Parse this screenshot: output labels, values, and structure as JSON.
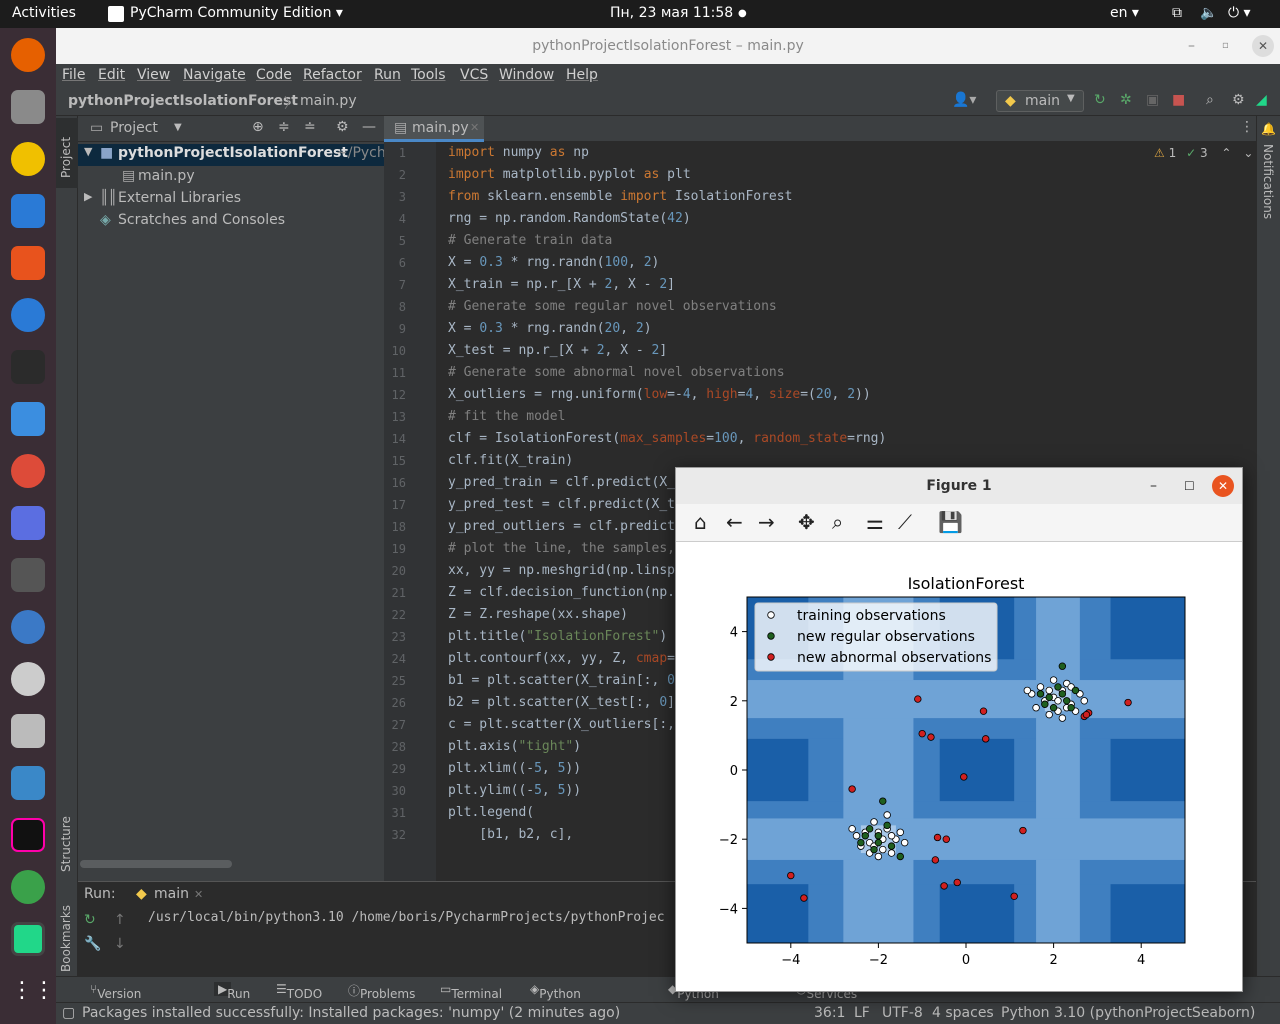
{
  "topbar": {
    "activities": "Activities",
    "app": "PyCharm Community Edition ▾",
    "datetime": "Пн, 23 мая  11:58",
    "lang": "en ▾"
  },
  "window": {
    "title": "pythonProjectIsolationForest – main.py"
  },
  "menu": [
    "File",
    "Edit",
    "View",
    "Navigate",
    "Code",
    "Refactor",
    "Run",
    "Tools",
    "VCS",
    "Window",
    "Help"
  ],
  "nav": {
    "project": "pythonProjectIsolationForest",
    "file": "main.py",
    "run_config": "main"
  },
  "project_panel": {
    "title": "Project",
    "root": "pythonProjectIsolationForest",
    "root_path": "~/Pych",
    "file": "main.py",
    "external": "External Libraries",
    "scratches": "Scratches and Consoles"
  },
  "sidebar": {
    "project": "Project",
    "structure": "Structure",
    "bookmarks": "Bookmarks",
    "notifications": "Notifications"
  },
  "editor": {
    "tab": "main.py",
    "inspections": {
      "warnings": "1",
      "ok": "3"
    },
    "line_numbers": [
      "1",
      "2",
      "3",
      "4",
      "5",
      "6",
      "7",
      "8",
      "9",
      "10",
      "11",
      "12",
      "13",
      "14",
      "15",
      "16",
      "17",
      "18",
      "19",
      "20",
      "21",
      "22",
      "23",
      "24",
      "25",
      "26",
      "27",
      "28",
      "29",
      "30",
      "31",
      "32"
    ]
  },
  "run_panel": {
    "label": "Run:",
    "tab": "main",
    "command": "/usr/local/bin/python3.10 /home/boris/PycharmProjects/pythonProjec"
  },
  "tool_windows": [
    "Version Control",
    "Run",
    "TODO",
    "Problems",
    "Terminal",
    "Python Packages",
    "Python Console",
    "Services"
  ],
  "status": {
    "message": "Packages installed successfully: Installed packages: 'numpy' (2 minutes ago)",
    "position": "36:1",
    "line_sep": "LF",
    "encoding": "UTF-8",
    "indent": "4 spaces",
    "interpreter": "Python 3.10 (pythonProjectSeaborn)"
  },
  "figure": {
    "window_title": "Figure 1"
  },
  "chart_data": {
    "type": "scatter",
    "title": "IsolationForest",
    "xlim": [
      -5,
      5
    ],
    "ylim": [
      -5,
      5
    ],
    "xticks": [
      -4,
      -2,
      0,
      2,
      4
    ],
    "yticks": [
      -4,
      -2,
      0,
      2,
      4
    ],
    "legend_position": "top-left",
    "background": "contourf (Blues)",
    "series": [
      {
        "name": "training observations",
        "color": "#ffffff",
        "points": [
          [
            2.0,
            2.1
          ],
          [
            2.2,
            2.3
          ],
          [
            1.8,
            2.0
          ],
          [
            2.4,
            1.9
          ],
          [
            2.1,
            1.7
          ],
          [
            1.7,
            2.4
          ],
          [
            2.3,
            2.5
          ],
          [
            2.6,
            2.2
          ],
          [
            1.9,
            1.6
          ],
          [
            2.5,
            1.7
          ],
          [
            1.5,
            2.2
          ],
          [
            2.0,
            2.6
          ],
          [
            2.2,
            1.5
          ],
          [
            1.6,
            1.8
          ],
          [
            2.7,
            2.0
          ],
          [
            1.4,
            2.3
          ],
          [
            2.4,
            2.4
          ],
          [
            2.1,
            2.0
          ],
          [
            1.9,
            2.3
          ],
          [
            2.3,
            1.8
          ],
          [
            -2.0,
            -1.9
          ],
          [
            -1.8,
            -1.7
          ],
          [
            -2.2,
            -2.1
          ],
          [
            -1.6,
            -2.0
          ],
          [
            -2.3,
            -1.8
          ],
          [
            -1.9,
            -2.3
          ],
          [
            -2.1,
            -1.5
          ],
          [
            -1.7,
            -2.4
          ],
          [
            -2.4,
            -2.2
          ],
          [
            -1.5,
            -1.8
          ],
          [
            -2.0,
            -2.5
          ],
          [
            -2.5,
            -1.9
          ],
          [
            -1.8,
            -1.3
          ],
          [
            -2.2,
            -2.4
          ],
          [
            -1.4,
            -2.1
          ],
          [
            -2.6,
            -1.7
          ],
          [
            -2.0,
            -1.8
          ],
          [
            -1.9,
            -2.0
          ],
          [
            -2.1,
            -2.2
          ],
          [
            -1.7,
            -1.9
          ]
        ]
      },
      {
        "name": "new regular observations",
        "color": "#1f5f1f",
        "points": [
          [
            2.2,
            3.0
          ],
          [
            1.9,
            2.1
          ],
          [
            2.3,
            2.0
          ],
          [
            2.0,
            1.8
          ],
          [
            2.5,
            2.3
          ],
          [
            1.7,
            2.2
          ],
          [
            2.1,
            2.4
          ],
          [
            2.4,
            1.8
          ],
          [
            1.8,
            1.9
          ],
          [
            2.2,
            2.2
          ],
          [
            -1.9,
            -0.9
          ],
          [
            -2.0,
            -1.9
          ],
          [
            -2.2,
            -1.7
          ],
          [
            -1.7,
            -2.2
          ],
          [
            -2.4,
            -2.1
          ],
          [
            -1.5,
            -2.5
          ],
          [
            -2.1,
            -2.3
          ],
          [
            -1.8,
            -1.6
          ],
          [
            -2.3,
            -1.9
          ],
          [
            -2.0,
            -2.1
          ]
        ]
      },
      {
        "name": "new abnormal observations",
        "color": "#d02020",
        "points": [
          [
            -1.1,
            2.05
          ],
          [
            0.4,
            1.7
          ],
          [
            -1.0,
            1.05
          ],
          [
            -0.8,
            0.95
          ],
          [
            0.45,
            0.9
          ],
          [
            -0.05,
            -0.2
          ],
          [
            -2.6,
            -0.55
          ],
          [
            -0.65,
            -1.95
          ],
          [
            1.3,
            -1.75
          ],
          [
            -0.7,
            -2.6
          ],
          [
            -4.0,
            -3.05
          ],
          [
            -3.7,
            -3.7
          ],
          [
            -0.5,
            -3.35
          ],
          [
            -0.2,
            -3.25
          ],
          [
            1.1,
            -3.65
          ],
          [
            2.7,
            1.55
          ],
          [
            2.8,
            1.65
          ],
          [
            3.7,
            1.95
          ],
          [
            2.75,
            1.6
          ],
          [
            -0.45,
            -2.0
          ]
        ]
      }
    ]
  }
}
